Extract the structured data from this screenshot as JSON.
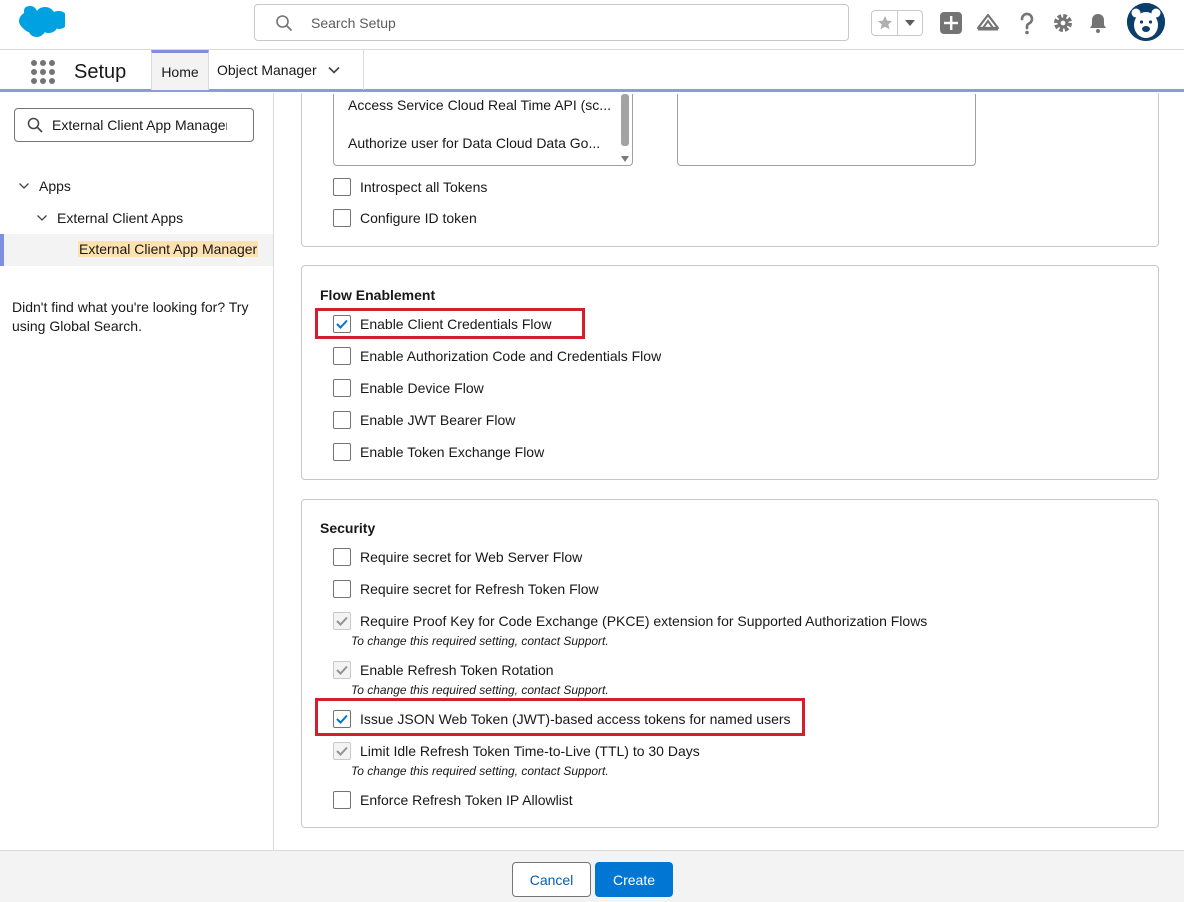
{
  "header": {
    "search_placeholder": "Search Setup",
    "icons": [
      "salesforce-cloud-logo",
      "search-icon",
      "star-icon",
      "chevron-down-icon",
      "add-icon",
      "trailhead-icon",
      "help-icon",
      "gear-icon",
      "bell-icon",
      "avatar"
    ]
  },
  "nav": {
    "app_name": "Setup",
    "tabs": [
      {
        "label": "Home",
        "active": true
      },
      {
        "label": "Object Manager"
      }
    ]
  },
  "sidebar": {
    "quickfind_value": "External Client App Manager",
    "tree": [
      {
        "label": "Apps",
        "level": 0,
        "expanded": true
      },
      {
        "label": "External Client Apps",
        "level": 1,
        "expanded": true
      },
      {
        "label": "External Client App Manager",
        "level": 2,
        "selected": true
      }
    ],
    "help_text": "Didn't find what you're looking for? Try using Global Search."
  },
  "oauth_scopes": {
    "options": [
      "Access Service Cloud Real Time API (sc...",
      "Authorize user for Data Cloud Data Go..."
    ],
    "checkboxes": [
      {
        "label": "Introspect all Tokens",
        "checked": false
      },
      {
        "label": "Configure ID token",
        "checked": false
      }
    ]
  },
  "flow_enablement": {
    "title": "Flow Enablement",
    "items": [
      {
        "label": "Enable Client Credentials Flow",
        "checked": true
      },
      {
        "label": "Enable Authorization Code and Credentials Flow",
        "checked": false
      },
      {
        "label": "Enable Device Flow",
        "checked": false
      },
      {
        "label": "Enable JWT Bearer Flow",
        "checked": false
      },
      {
        "label": "Enable Token Exchange Flow",
        "checked": false
      }
    ]
  },
  "security": {
    "title": "Security",
    "items": [
      {
        "label": "Require secret for Web Server Flow",
        "checked": false
      },
      {
        "label": "Require secret for Refresh Token Flow",
        "checked": false
      },
      {
        "label": "Require Proof Key for Code Exchange (PKCE) extension for Supported Authorization Flows",
        "checked": true,
        "disabled": true,
        "note": "To change this required setting, contact Support."
      },
      {
        "label": "Enable Refresh Token Rotation",
        "checked": true,
        "disabled": true,
        "note": "To change this required setting, contact Support."
      },
      {
        "label": "Issue JSON Web Token (JWT)-based access tokens for named users",
        "checked": true
      },
      {
        "label": "Limit Idle Refresh Token Time-to-Live (TTL) to 30 Days",
        "checked": true,
        "disabled": true,
        "note": "To change this required setting, contact Support."
      },
      {
        "label": "Enforce Refresh Token IP Allowlist",
        "checked": false
      }
    ]
  },
  "footer": {
    "cancel_label": "Cancel",
    "create_label": "Create"
  },
  "colors": {
    "brand_blue": "#0176d3",
    "highlight_red": "#d0202b",
    "tab_accent": "#7f8ee0"
  }
}
